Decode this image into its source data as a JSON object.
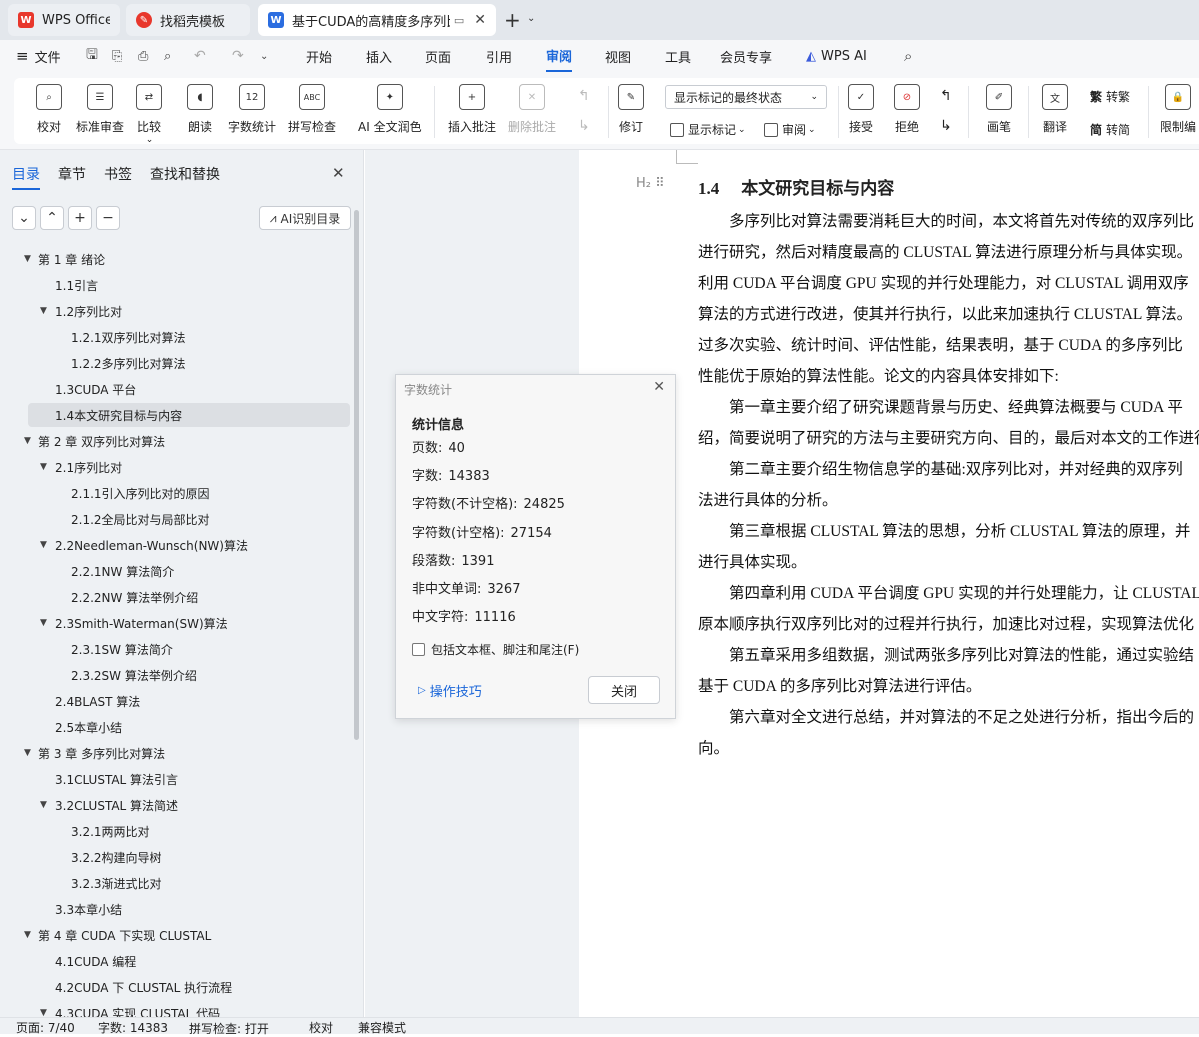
{
  "tabs": [
    {
      "label": "WPS Office"
    },
    {
      "label": "找稻壳模板"
    },
    {
      "label": "基于CUDA的高精度多序列比"
    }
  ],
  "menu": {
    "file": "文件",
    "items": [
      "开始",
      "插入",
      "页面",
      "引用",
      "审阅",
      "视图",
      "工具",
      "会员专享"
    ],
    "active": "审阅",
    "ai": "WPS AI"
  },
  "ribbon": {
    "proofread": "校对",
    "standard_review": "标准审查",
    "compare": "比较",
    "read_aloud": "朗读",
    "word_count": "字数统计",
    "spell_check": "拼写检查",
    "ai_polish": "AI 全文润色",
    "insert_comment": "插入批注",
    "delete_comment": "删除批注",
    "track_changes": "修订",
    "markup_select": "显示标记的最终状态",
    "show_markup": "显示标记",
    "review": "审阅",
    "accept": "接受",
    "reject": "拒绝",
    "pen": "画笔",
    "translate": "翻译",
    "to_traditional": "转繁",
    "to_simplified": "转简",
    "restrict": "限制编"
  },
  "sidebar": {
    "tabs": [
      "目录",
      "章节",
      "书签",
      "查找和替换"
    ],
    "ai_toc": "AI识别目录",
    "toc": [
      {
        "label": "第 1 章  绪论",
        "level": 0,
        "arrow": true
      },
      {
        "label": "1.1引言",
        "level": 1,
        "arrow": false
      },
      {
        "label": "1.2序列比对",
        "level": 1,
        "arrow": true
      },
      {
        "label": "1.2.1双序列比对算法",
        "level": 2,
        "arrow": false
      },
      {
        "label": "1.2.2多序列比对算法",
        "level": 2,
        "arrow": false
      },
      {
        "label": "1.3CUDA 平台",
        "level": 1,
        "arrow": false
      },
      {
        "label": "1.4本文研究目标与内容",
        "level": 1,
        "arrow": false,
        "selected": true
      },
      {
        "label": "第 2 章  双序列比对算法",
        "level": 0,
        "arrow": true
      },
      {
        "label": "2.1序列比对",
        "level": 1,
        "arrow": true
      },
      {
        "label": "2.1.1引入序列比对的原因",
        "level": 2,
        "arrow": false
      },
      {
        "label": "2.1.2全局比对与局部比对",
        "level": 2,
        "arrow": false
      },
      {
        "label": "2.2Needleman-Wunsch(NW)算法",
        "level": 1,
        "arrow": true
      },
      {
        "label": "2.2.1NW 算法简介",
        "level": 2,
        "arrow": false
      },
      {
        "label": "2.2.2NW 算法举例介绍",
        "level": 2,
        "arrow": false
      },
      {
        "label": "2.3Smith-Waterman(SW)算法",
        "level": 1,
        "arrow": true
      },
      {
        "label": "2.3.1SW 算法简介",
        "level": 2,
        "arrow": false
      },
      {
        "label": "2.3.2SW 算法举例介绍",
        "level": 2,
        "arrow": false
      },
      {
        "label": "2.4BLAST 算法",
        "level": 1,
        "arrow": false
      },
      {
        "label": "2.5本章小结",
        "level": 1,
        "arrow": false
      },
      {
        "label": "第 3 章  多序列比对算法",
        "level": 0,
        "arrow": true
      },
      {
        "label": "3.1CLUSTAL 算法引言",
        "level": 1,
        "arrow": false
      },
      {
        "label": "3.2CLUSTAL 算法简述",
        "level": 1,
        "arrow": true
      },
      {
        "label": "3.2.1两两比对",
        "level": 2,
        "arrow": false
      },
      {
        "label": "3.2.2构建向导树",
        "level": 2,
        "arrow": false
      },
      {
        "label": "3.2.3渐进式比对",
        "level": 2,
        "arrow": false
      },
      {
        "label": "3.3本章小结",
        "level": 1,
        "arrow": false
      },
      {
        "label": "第 4 章  CUDA 下实现 CLUSTAL",
        "level": 0,
        "arrow": true
      },
      {
        "label": "4.1CUDA 编程",
        "level": 1,
        "arrow": false
      },
      {
        "label": "4.2CUDA 下 CLUSTAL 执行流程",
        "level": 1,
        "arrow": false
      },
      {
        "label": "4.3CUDA 实现 CLUSTAL 代码",
        "level": 1,
        "arrow": true
      }
    ]
  },
  "document": {
    "heading_num": "1.4",
    "heading_text": "本文研究目标与内容",
    "lines": [
      "　　多序列比对算法需要消耗巨大的时间，本文将首先对传统的双序列比",
      "进行研究，然后对精度最高的 CLUSTAL 算法进行原理分析与具体实现。",
      "利用 CUDA 平台调度 GPU 实现的并行处理能力，对 CLUSTAL 调用双序",
      "算法的方式进行改进，使其并行执行，以此来加速执行 CLUSTAL 算法。",
      "过多次实验、统计时间、评估性能，结果表明，基于 CUDA 的多序列比",
      "性能优于原始的算法性能。论文的内容具体安排如下:",
      "　　第一章主要介绍了研究课题背景与历史、经典算法概要与 CUDA 平",
      "绍，简要说明了研究的方法与主要研究方向、目的，最后对本文的工作进行",
      "　　第二章主要介绍生物信息学的基础:双序列比对，并对经典的双序列",
      "法进行具体的分析。",
      "　　第三章根据 CLUSTAL 算法的思想，分析 CLUSTAL 算法的原理，并",
      "进行具体实现。",
      "　　第四章利用 CUDA 平台调度 GPU 实现的并行处理能力，让 CLUSTAL",
      "原本顺序执行双序列比对的过程并行执行，加速比对过程，实现算法优化",
      "　　第五章采用多组数据，测试两张多序列比对算法的性能，通过实验结",
      "基于 CUDA 的多序列比对算法进行评估。",
      "　　第六章对全文进行总结，并对算法的不足之处进行分析，指出今后的",
      "向。"
    ]
  },
  "dialog": {
    "title": "字数统计",
    "section": "统计信息",
    "stats": [
      {
        "label": "页数:",
        "value": "40"
      },
      {
        "label": "字数:",
        "value": "14383"
      },
      {
        "label": "字符数(不计空格):",
        "value": "24825"
      },
      {
        "label": "字符数(计空格):",
        "value": "27154"
      },
      {
        "label": "段落数:",
        "value": "1391"
      },
      {
        "label": "非中文单词:",
        "value": "3267"
      },
      {
        "label": "中文字符:",
        "value": "11116"
      }
    ],
    "checkbox_label": "包括文本框、脚注和尾注(F)",
    "tips_link": "操作技巧",
    "close_button": "关闭"
  },
  "status": {
    "page": "页面: 7/40",
    "words": "字数: 14383",
    "spell": "拼写检查: 打开",
    "proof": "校对",
    "compat": "兼容模式"
  },
  "colors": {
    "accent": "#1a66d9",
    "wps_red": "#e8372c",
    "doc_blue": "#2b6de0"
  }
}
